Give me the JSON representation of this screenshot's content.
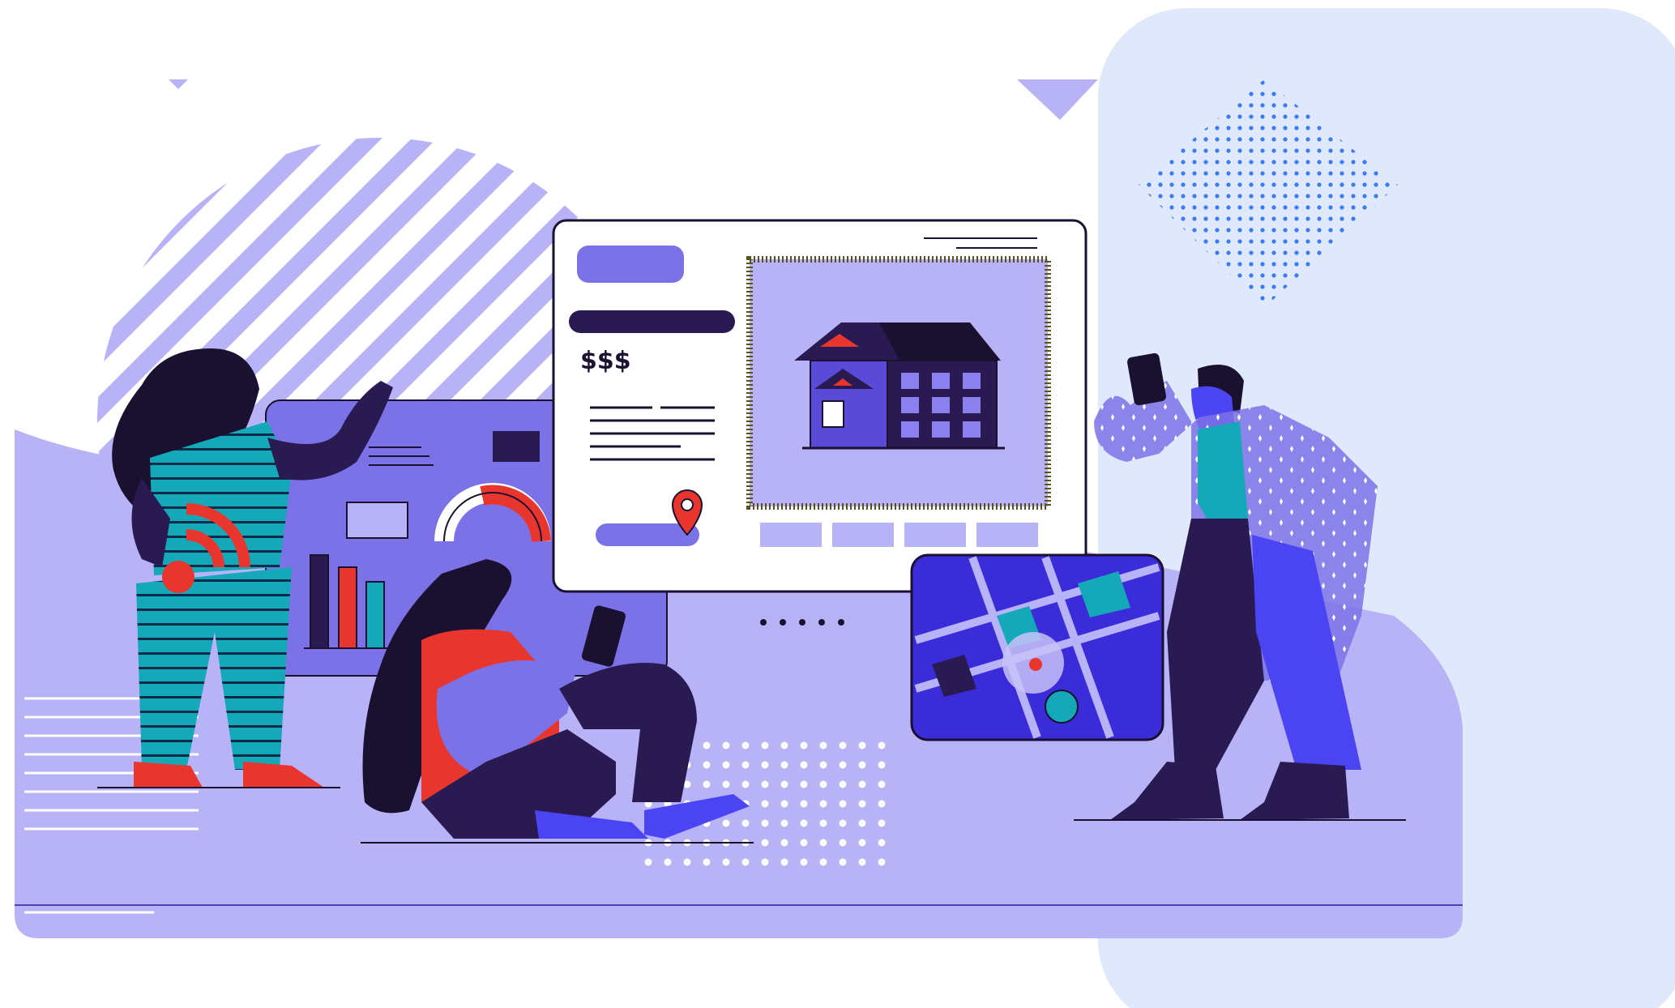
{
  "illustration": {
    "subject": "real-estate-app-scene",
    "listing_card": {
      "price_label": "$$$",
      "icon_house": "house-icon",
      "icon_pin": "map-pin-icon"
    },
    "carousel_dots": 5,
    "colors": {
      "primary": "#7c72e8",
      "light_lavender": "#b8b2f7",
      "dark_navy": "#2a1a52",
      "red": "#e8362f",
      "teal": "#14a8b8",
      "blue": "#4a44f2",
      "panel_bg": "#dfe9fb",
      "dot_blue": "#3a7cf2"
    }
  }
}
